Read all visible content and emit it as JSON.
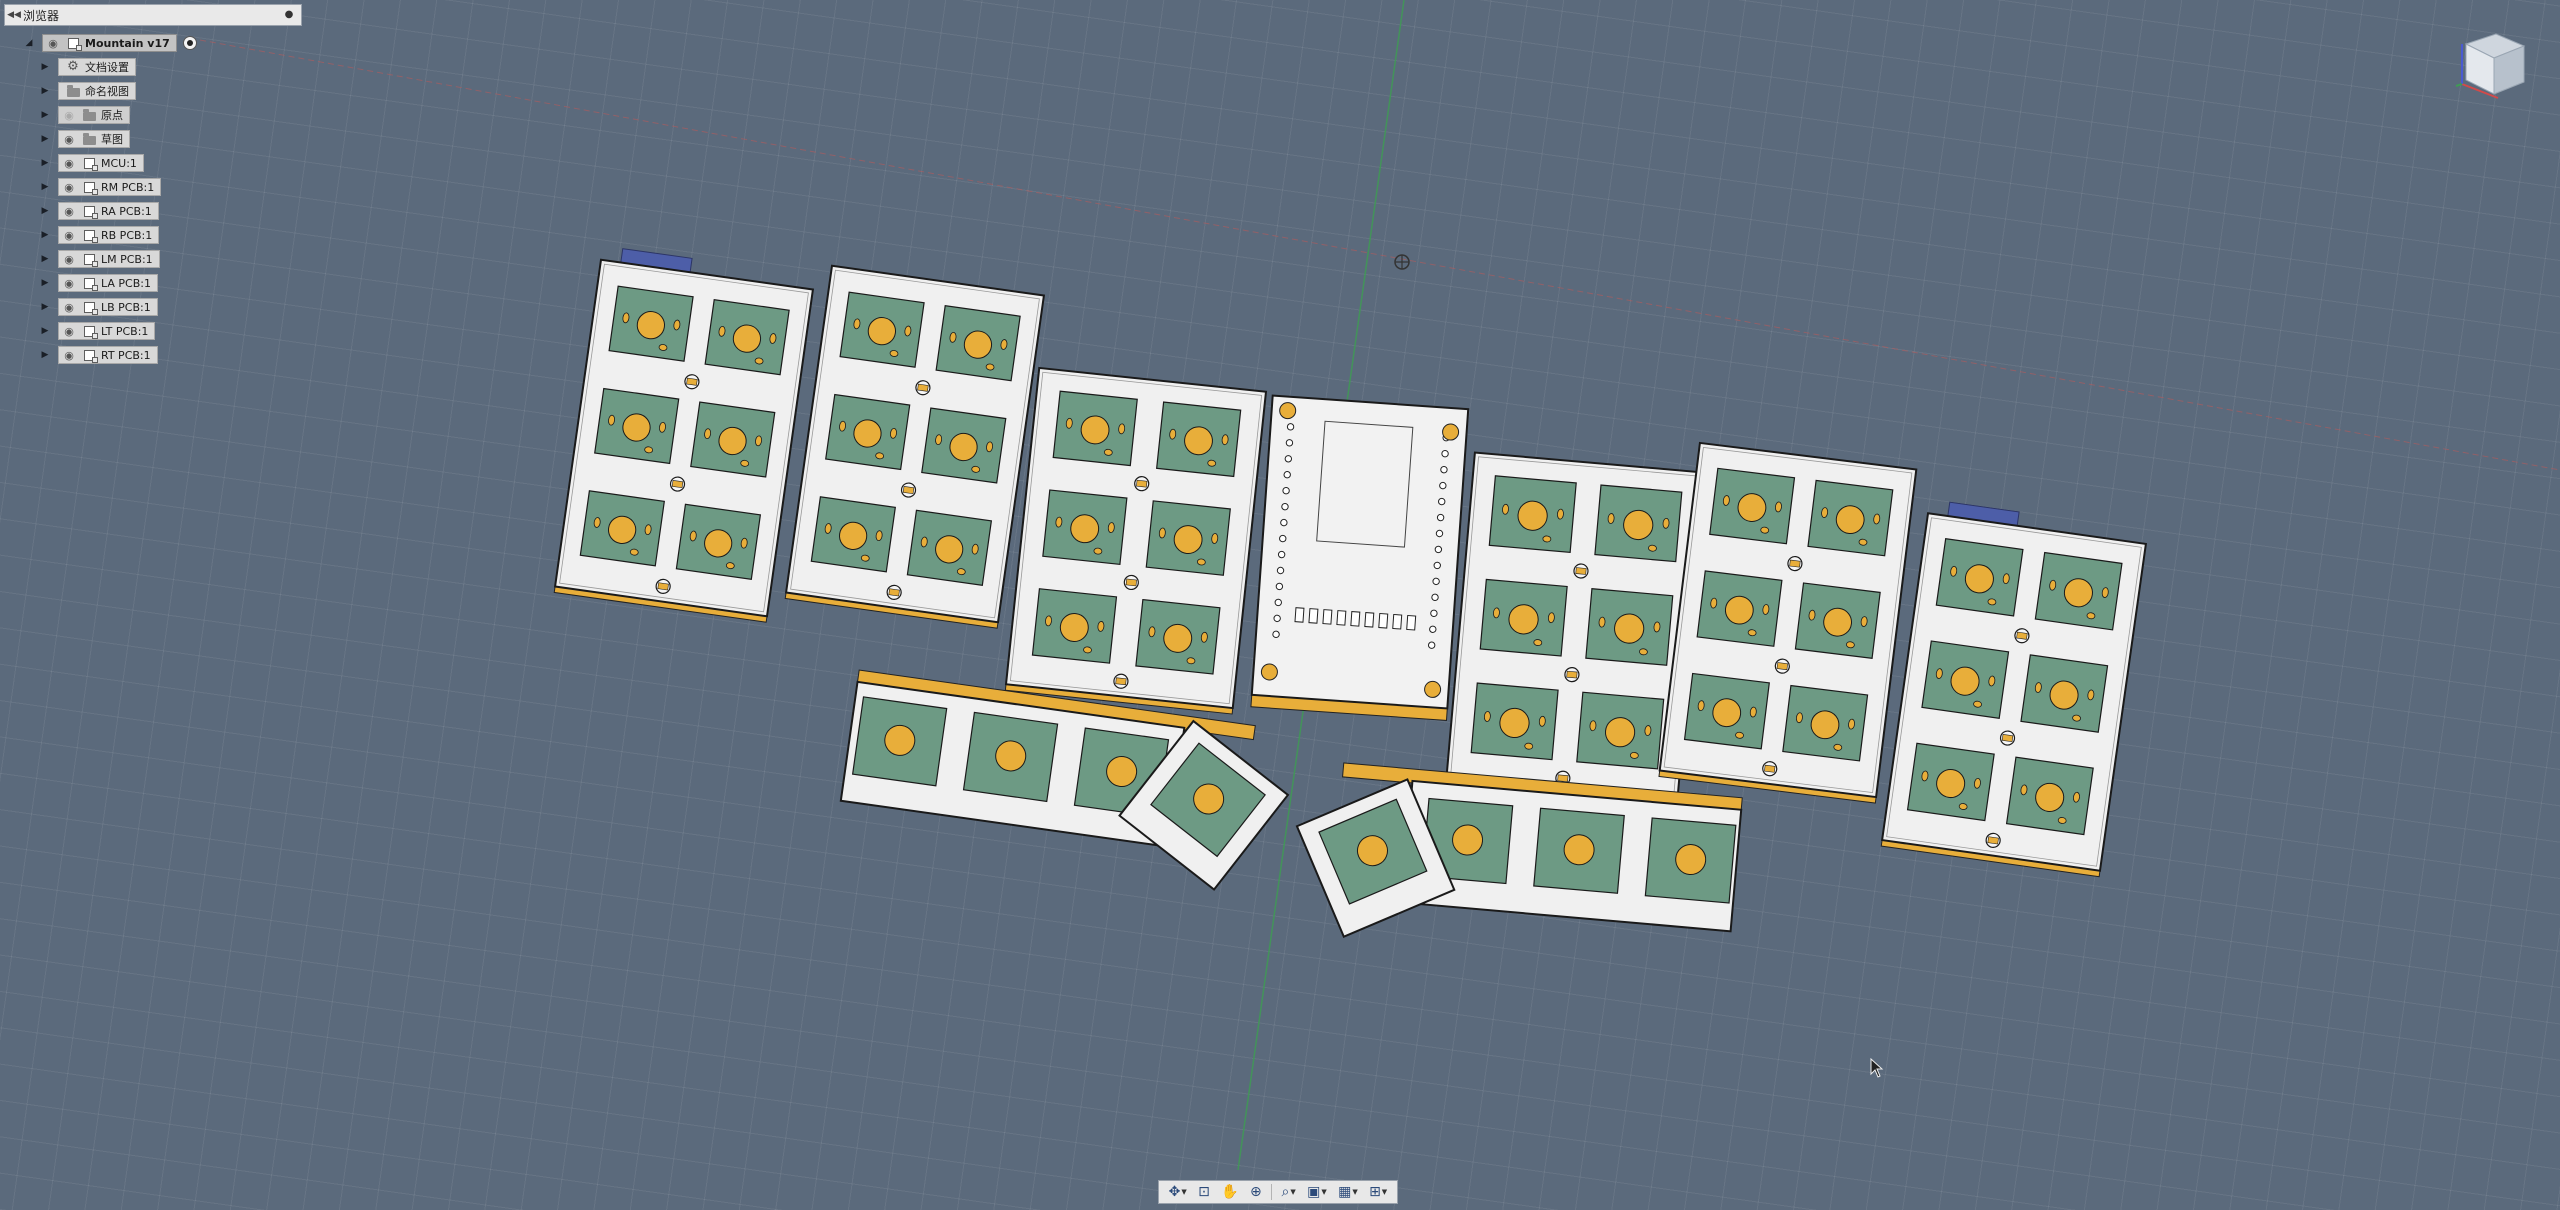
{
  "browser": {
    "title": "浏览器",
    "root": {
      "label": "Mountain v17"
    },
    "items": [
      {
        "label": "文档设置",
        "icon": "gear-icon",
        "visible": null
      },
      {
        "label": "命名视图",
        "icon": "folder-icon",
        "visible": null
      },
      {
        "label": "原点",
        "icon": "folder-icon",
        "visible": false
      },
      {
        "label": "草图",
        "icon": "folder-icon",
        "visible": true
      },
      {
        "label": "MCU:1",
        "icon": "component-icon",
        "visible": true
      },
      {
        "label": "RM PCB:1",
        "icon": "component-icon",
        "visible": true
      },
      {
        "label": "RA PCB:1",
        "icon": "component-icon",
        "visible": true
      },
      {
        "label": "RB PCB:1",
        "icon": "component-icon",
        "visible": true
      },
      {
        "label": "LM PCB:1",
        "icon": "component-icon",
        "visible": true
      },
      {
        "label": "LA PCB:1",
        "icon": "component-icon",
        "visible": true
      },
      {
        "label": "LB PCB:1",
        "icon": "component-icon",
        "visible": true
      },
      {
        "label": "LT PCB:1",
        "icon": "component-icon",
        "visible": true
      },
      {
        "label": "RT PCB:1",
        "icon": "component-icon",
        "visible": true
      }
    ]
  },
  "nav_tools": [
    {
      "name": "orbit-tool",
      "glyph": "✥",
      "dropdown": true
    },
    {
      "name": "look-at-tool",
      "glyph": "⊡",
      "dropdown": false
    },
    {
      "name": "pan-tool",
      "glyph": "✋",
      "dropdown": false
    },
    {
      "name": "zoom-tool",
      "glyph": "⊕",
      "dropdown": false
    },
    {
      "name": "fit-tool",
      "glyph": "⌕",
      "dropdown": true
    },
    {
      "name": "display-settings-tool",
      "glyph": "▣",
      "dropdown": true
    },
    {
      "name": "grid-settings-tool",
      "glyph": "▦",
      "dropdown": true
    },
    {
      "name": "viewports-tool",
      "glyph": "⊞",
      "dropdown": true
    }
  ],
  "colors": {
    "background": "#5b6a7c",
    "pcb_surface": "#f0f0f0",
    "key_socket": "#6d9a84",
    "key_hole": "#e8ae3a",
    "edge_orange": "#e8ae3a",
    "plate_blue": "#4d5ea8"
  }
}
